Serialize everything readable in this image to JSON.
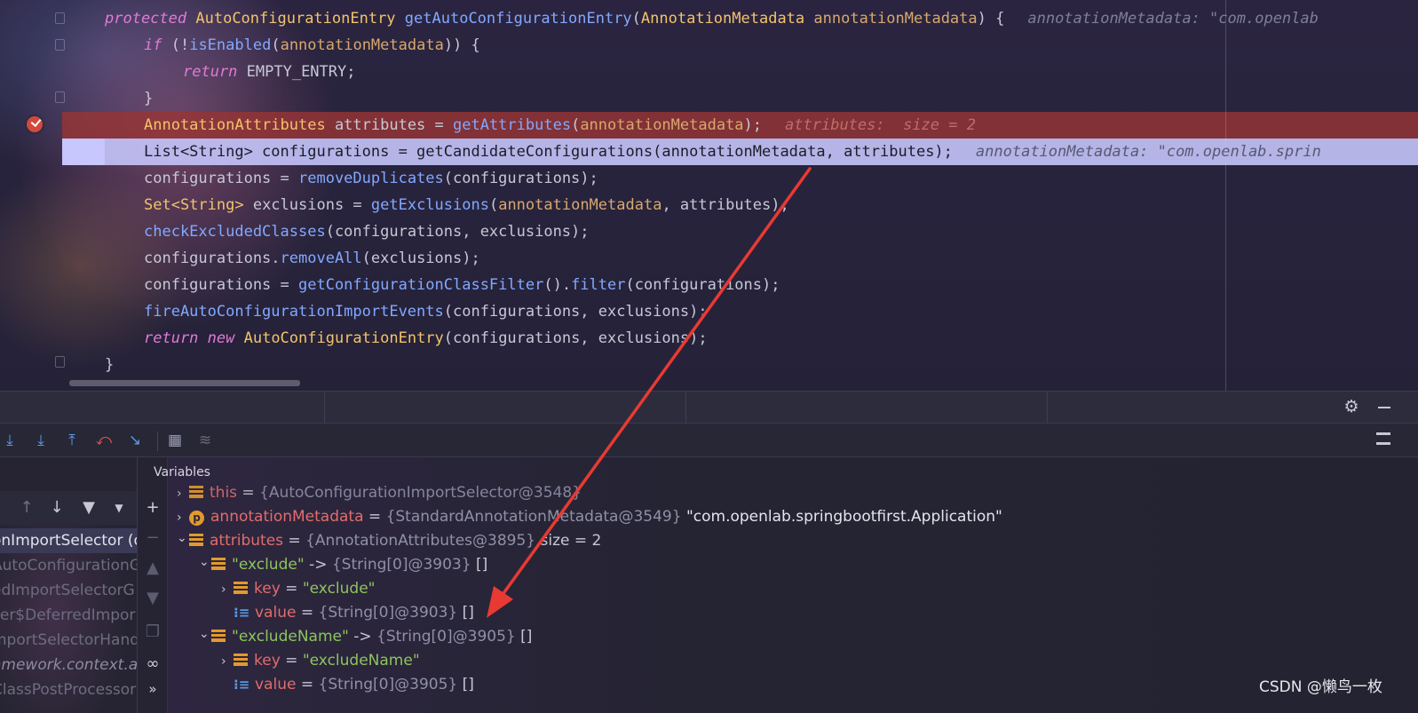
{
  "editor": {
    "lines": [
      {
        "tokens": [
          [
            "kw",
            "protected"
          ],
          [
            "p",
            " "
          ],
          [
            "type",
            "AutoConfigurationEntry"
          ],
          [
            "p",
            " "
          ],
          [
            "fn",
            "getAutoConfigurationEntry"
          ],
          [
            "p",
            "("
          ],
          [
            "type",
            "AnnotationMetadata"
          ],
          [
            "p",
            " "
          ],
          [
            "param",
            "annotationMetadata"
          ],
          [
            "p",
            ") {"
          ]
        ],
        "hint": "annotationMetadata: \"com.openlab",
        "indent": 1,
        "style": ""
      },
      {
        "tokens": [
          [
            "kw",
            "if"
          ],
          [
            "p",
            " (!"
          ],
          [
            "fn",
            "isEnabled"
          ],
          [
            "p",
            "("
          ],
          [
            "param",
            "annotationMetadata"
          ],
          [
            "p",
            ")) {"
          ]
        ],
        "hint": "",
        "indent": 2,
        "style": ""
      },
      {
        "tokens": [
          [
            "kw",
            "return"
          ],
          [
            "p",
            " EMPTY_ENTRY;"
          ]
        ],
        "hint": "",
        "indent": 3,
        "style": ""
      },
      {
        "tokens": [
          [
            "p",
            "}"
          ]
        ],
        "hint": "",
        "indent": 2,
        "style": ""
      },
      {
        "tokens": [
          [
            "type",
            "AnnotationAttributes"
          ],
          [
            "p",
            " attributes = "
          ],
          [
            "fn",
            "getAttributes"
          ],
          [
            "p",
            "("
          ],
          [
            "param",
            "annotationMetadata"
          ],
          [
            "p",
            ");"
          ]
        ],
        "hint": "attributes:  size = 2",
        "indent": 2,
        "style": "hl-red"
      },
      {
        "tokens": [
          [
            "p",
            "List<String> configurations = getCandidateConfigurations(annotationMetadata, attributes);"
          ]
        ],
        "hint": "annotationMetadata: \"com.openlab.sprin",
        "indent": 2,
        "style": "hl-exec"
      },
      {
        "tokens": [
          [
            "p",
            "configurations = "
          ],
          [
            "fn",
            "removeDuplicates"
          ],
          [
            "p",
            "(configurations);"
          ]
        ],
        "hint": "",
        "indent": 2,
        "style": ""
      },
      {
        "tokens": [
          [
            "type",
            "Set<String>"
          ],
          [
            "p",
            " exclusions = "
          ],
          [
            "fn",
            "getExclusions"
          ],
          [
            "p",
            "("
          ],
          [
            "param",
            "annotationMetadata"
          ],
          [
            "p",
            ", attributes);"
          ]
        ],
        "hint": "",
        "indent": 2,
        "style": ""
      },
      {
        "tokens": [
          [
            "fn",
            "checkExcludedClasses"
          ],
          [
            "p",
            "(configurations, exclusions);"
          ]
        ],
        "hint": "",
        "indent": 2,
        "style": ""
      },
      {
        "tokens": [
          [
            "p",
            "configurations."
          ],
          [
            "fn",
            "removeAll"
          ],
          [
            "p",
            "(exclusions);"
          ]
        ],
        "hint": "",
        "indent": 2,
        "style": ""
      },
      {
        "tokens": [
          [
            "p",
            "configurations = "
          ],
          [
            "fn",
            "getConfigurationClassFilter"
          ],
          [
            "p",
            "()."
          ],
          [
            "fn",
            "filter"
          ],
          [
            "p",
            "(configurations);"
          ]
        ],
        "hint": "",
        "indent": 2,
        "style": ""
      },
      {
        "tokens": [
          [
            "fn",
            "fireAutoConfigurationImportEvents"
          ],
          [
            "p",
            "(configurations, exclusions);"
          ]
        ],
        "hint": "",
        "indent": 2,
        "style": ""
      },
      {
        "tokens": [
          [
            "kw",
            "return new"
          ],
          [
            "p",
            " "
          ],
          [
            "type",
            "AutoConfigurationEntry"
          ],
          [
            "p",
            "(configurations, exclusions);"
          ]
        ],
        "hint": "",
        "indent": 2,
        "style": ""
      },
      {
        "tokens": [
          [
            "p",
            "}"
          ]
        ],
        "hint": "",
        "indent": 1,
        "style": ""
      }
    ]
  },
  "toolbar": {
    "icons": [
      "step-over-icon",
      "step-into-icon",
      "force-step-into-icon",
      "step-out-icon",
      "drop-frame-icon",
      "run-to-cursor-icon",
      "evaluate-expression-icon",
      "trace-current-stream-icon"
    ]
  },
  "frames": {
    "rows": [
      {
        "text": "onImportSelector (o",
        "style": "selected"
      },
      {
        "text": "AutoConfigurationG",
        "style": "dim"
      },
      {
        "text": "edImportSelectorG",
        "style": "dim"
      },
      {
        "text": "ser$DeferredImpor",
        "style": "dim"
      },
      {
        "text": "mportSelectorHand",
        "style": "dim"
      },
      {
        "text": "amework.context.a",
        "style": "italic"
      },
      {
        "text": "ClassPostProcessor",
        "style": "dim"
      }
    ]
  },
  "variables": {
    "title": "Variables",
    "rows": [
      {
        "depth": 0,
        "chev": "›",
        "icon": "field",
        "name": "this",
        "nameClass": "vname",
        "eq": " = ",
        "type": "{AutoConfigurationImportSelector@3548}",
        "val": ""
      },
      {
        "depth": 0,
        "chev": "›",
        "icon": "param",
        "name": "annotationMetadata",
        "nameClass": "vname",
        "eq": " = ",
        "type": "{StandardAnnotationMetadata@3549}",
        "val": " \"com.openlab.springbootfirst.Application\""
      },
      {
        "depth": 0,
        "chev": "⌄",
        "icon": "field",
        "name": "attributes",
        "nameClass": "vname",
        "eq": " = ",
        "type": "{AnnotationAttributes@3895}",
        "val": "  size = 2"
      },
      {
        "depth": 1,
        "chev": "⌄",
        "icon": "field",
        "name": "\"exclude\"",
        "nameClass": "vkey",
        "eq": " -> ",
        "type": "{String[0]@3903}",
        "val": " []"
      },
      {
        "depth": 2,
        "chev": "›",
        "icon": "field",
        "name": "key",
        "nameClass": "vname",
        "eq": " = ",
        "type": "",
        "val": "\"exclude\"",
        "valClass": "vkey"
      },
      {
        "depth": 2,
        "chev": "",
        "icon": "array",
        "name": "value",
        "nameClass": "vname",
        "eq": " = ",
        "type": "{String[0]@3903}",
        "val": " []"
      },
      {
        "depth": 1,
        "chev": "⌄",
        "icon": "field",
        "name": "\"excludeName\"",
        "nameClass": "vkey",
        "eq": " -> ",
        "type": "{String[0]@3905}",
        "val": " []"
      },
      {
        "depth": 2,
        "chev": "›",
        "icon": "field",
        "name": "key",
        "nameClass": "vname",
        "eq": " = ",
        "type": "",
        "val": "\"excludeName\"",
        "valClass": "vkey"
      },
      {
        "depth": 2,
        "chev": "",
        "icon": "array",
        "name": "value",
        "nameClass": "vname",
        "eq": " = ",
        "type": "{String[0]@3905}",
        "val": " []"
      }
    ]
  },
  "watermark": "CSDN @懒鸟一枚",
  "colors": {
    "accent_arrow": "#e83a32",
    "breakpoint": "#d04a3c",
    "exec_line": "#c8c8ff"
  }
}
